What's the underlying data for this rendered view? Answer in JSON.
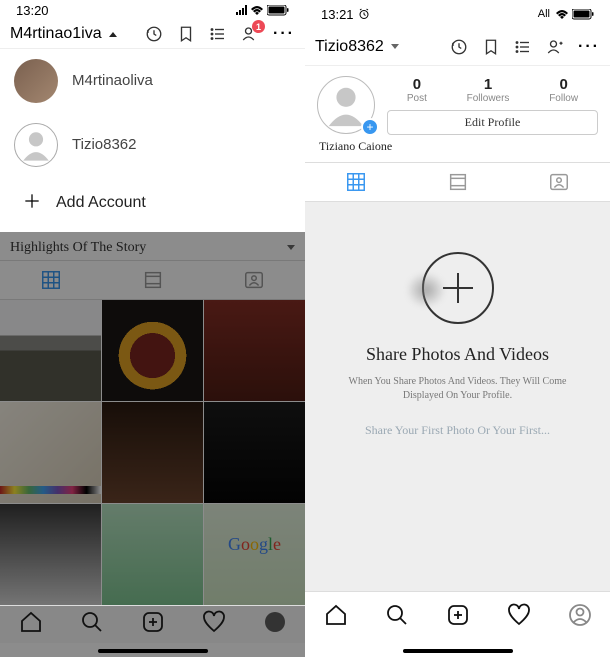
{
  "left": {
    "status": {
      "time": "13:20",
      "network": "All"
    },
    "header": {
      "username": "M4rtinao1iva",
      "badge_count": "1"
    },
    "accounts": [
      {
        "name": "M4rtinaoliva",
        "has_photo": true
      },
      {
        "name": "Tizio8362",
        "has_photo": false
      }
    ],
    "add_account": "Add Account",
    "highlights_label": "Highlights Of The Story"
  },
  "right": {
    "status": {
      "time": "13:21",
      "network": "All"
    },
    "header": {
      "username": "Tizio8362"
    },
    "stats": {
      "post_num": "0",
      "post_label": "Post",
      "followers_num": "1",
      "followers_label": "Followers",
      "follow_num": "0",
      "follow_label": "Follow"
    },
    "edit_profile": "Edit Profile",
    "display_name": "Tiziano Caione",
    "empty": {
      "title": "Share Photos And Videos",
      "subtitle": "When You Share Photos And Videos. They Will Come Displayed On Your Profile.",
      "link": "Share Your First Photo Or Your First..."
    }
  }
}
